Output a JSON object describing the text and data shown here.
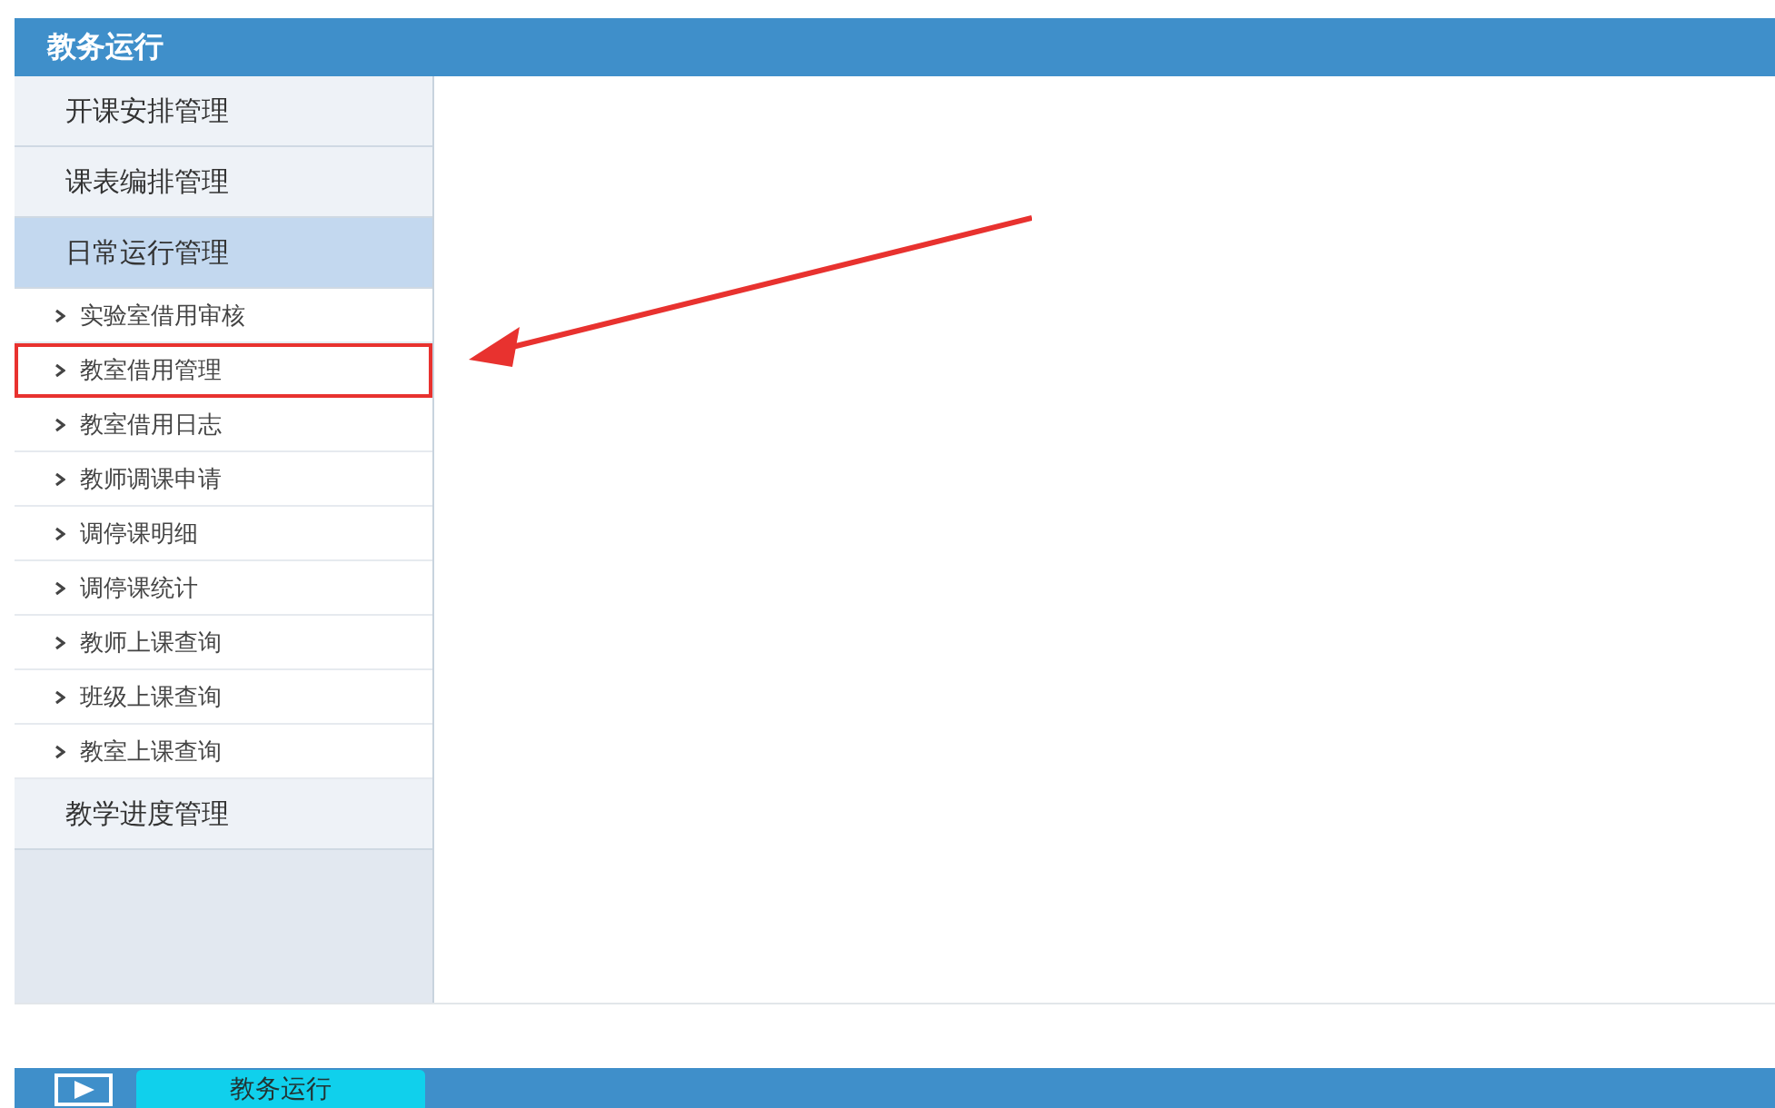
{
  "window": {
    "title": "教务运行"
  },
  "sidebar": {
    "groups": [
      {
        "label": "开课安排管理",
        "expanded": false
      },
      {
        "label": "课表编排管理",
        "expanded": false
      },
      {
        "label": "日常运行管理",
        "expanded": true,
        "items": [
          {
            "label": "实验室借用审核",
            "highlighted": false
          },
          {
            "label": "教室借用管理",
            "highlighted": true
          },
          {
            "label": "教室借用日志",
            "highlighted": false
          },
          {
            "label": "教师调课申请",
            "highlighted": false
          },
          {
            "label": "调停课明细",
            "highlighted": false
          },
          {
            "label": "调停课统计",
            "highlighted": false
          },
          {
            "label": "教师上课查询",
            "highlighted": false
          },
          {
            "label": "班级上课查询",
            "highlighted": false
          },
          {
            "label": "教室上课查询",
            "highlighted": false
          }
        ]
      },
      {
        "label": "教学进度管理",
        "expanded": false
      }
    ]
  },
  "taskbar": {
    "tabs": [
      {
        "label": "教务运行",
        "selected": true
      }
    ]
  }
}
